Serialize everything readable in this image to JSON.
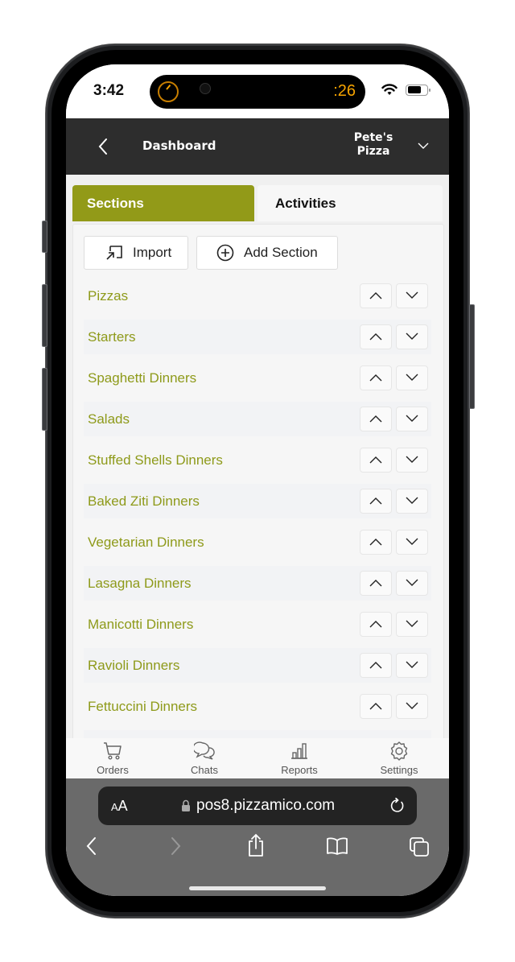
{
  "status_bar": {
    "time": "3:42",
    "island_timer": ":26"
  },
  "header": {
    "back_icon": "chevron-left-icon",
    "title": "Dashboard",
    "store_line1": "Pete's",
    "store_line2": "Pizza",
    "store_dropdown_icon": "chevron-down-icon"
  },
  "tabs": [
    {
      "label": "Sections",
      "active": true
    },
    {
      "label": "Activities",
      "active": false
    }
  ],
  "actions": {
    "import_label": "Import",
    "add_section_label": "Add Section"
  },
  "sections": [
    {
      "name": "Pizzas"
    },
    {
      "name": "Starters"
    },
    {
      "name": "Spaghetti Dinners"
    },
    {
      "name": "Salads"
    },
    {
      "name": "Stuffed Shells Dinners"
    },
    {
      "name": "Baked Ziti Dinners"
    },
    {
      "name": "Vegetarian Dinners"
    },
    {
      "name": "Lasagna Dinners"
    },
    {
      "name": "Manicotti Dinners"
    },
    {
      "name": "Ravioli Dinners"
    },
    {
      "name": "Fettuccini Dinners"
    }
  ],
  "bottom_nav": [
    {
      "label": "Orders",
      "icon": "cart-icon"
    },
    {
      "label": "Chats",
      "icon": "chat-bubbles-icon"
    },
    {
      "label": "Reports",
      "icon": "bar-chart-icon"
    },
    {
      "label": "Settings",
      "icon": "gear-icon"
    }
  ],
  "browser": {
    "text_size_label_small": "A",
    "text_size_label_large": "A",
    "url": "pos8.pizzamico.com"
  },
  "colors": {
    "accent": "#929a18",
    "section_text": "#8e9a1a",
    "header_bg": "#2d2d2d"
  }
}
